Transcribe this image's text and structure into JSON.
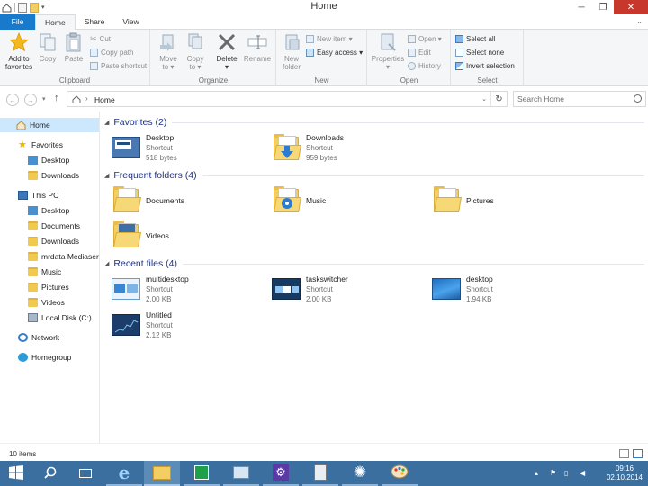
{
  "window": {
    "title": "Home",
    "minimize": "─",
    "maximize": "❐",
    "close": "✕"
  },
  "ribbon_tabs": [
    {
      "label": "File"
    },
    {
      "label": "Home"
    },
    {
      "label": "Share"
    },
    {
      "label": "View"
    }
  ],
  "ribbon": {
    "clipboard": {
      "label": "Clipboard",
      "add_to_favorites": "Add to\nfavorites",
      "copy": "Copy",
      "paste": "Paste",
      "cut": "Cut",
      "copy_path": "Copy path",
      "paste_shortcut": "Paste shortcut"
    },
    "organize": {
      "label": "Organize",
      "move_to": "Move\nto ▾",
      "copy_to": "Copy\nto ▾",
      "delete": "Delete\n▾",
      "rename": "Rename"
    },
    "new": {
      "label": "New",
      "new_folder": "New\nfolder",
      "new_item": "New item ▾",
      "easy_access": "Easy access ▾"
    },
    "open": {
      "label": "Open",
      "properties": "Properties\n▾",
      "open": "Open ▾",
      "edit": "Edit",
      "history": "History"
    },
    "select": {
      "label": "Select",
      "select_all": "Select all",
      "select_none": "Select none",
      "invert_selection": "Invert selection"
    }
  },
  "address": {
    "location": "Home",
    "search_placeholder": "Search Home"
  },
  "nav": {
    "home": "Home",
    "favorites": "Favorites",
    "fav_desktop": "Desktop",
    "fav_downloads": "Downloads",
    "this_pc": "This PC",
    "pc_desktop": "Desktop",
    "pc_documents": "Documents",
    "pc_downloads": "Downloads",
    "pc_mrdata": "mrdata Mediaserv",
    "pc_music": "Music",
    "pc_pictures": "Pictures",
    "pc_videos": "Videos",
    "pc_local_disk": "Local Disk (C:)",
    "network": "Network",
    "homegroup": "Homegroup"
  },
  "sections": {
    "favorites": {
      "title": "Favorites (2)",
      "items": [
        {
          "name": "Desktop",
          "type": "Shortcut",
          "size": "518 bytes",
          "icon": "desktop-shortcut"
        },
        {
          "name": "Downloads",
          "type": "Shortcut",
          "size": "959 bytes",
          "icon": "downloads-folder"
        }
      ]
    },
    "frequent": {
      "title": "Frequent folders (4)",
      "items": [
        {
          "name": "Documents",
          "icon": "documents-folder"
        },
        {
          "name": "Music",
          "icon": "music-folder"
        },
        {
          "name": "Pictures",
          "icon": "pictures-folder"
        },
        {
          "name": "Videos",
          "icon": "videos-folder"
        }
      ]
    },
    "recent": {
      "title": "Recent files (4)",
      "items": [
        {
          "name": "multidesktop",
          "type": "Shortcut",
          "size": "2,00 KB",
          "icon": "multidesktop-thumb"
        },
        {
          "name": "taskswitcher",
          "type": "Shortcut",
          "size": "2,00 KB",
          "icon": "taskswitcher-thumb"
        },
        {
          "name": "desktop",
          "type": "Shortcut",
          "size": "1,94 KB",
          "icon": "desktop-thumb"
        },
        {
          "name": "Untitled",
          "type": "Shortcut",
          "size": "2,12 KB",
          "icon": "untitled-thumb"
        }
      ]
    }
  },
  "status": {
    "item_count": "10 items"
  },
  "taskbar": {
    "time": "09:16",
    "date": "02.10.2014"
  },
  "colors": {
    "accent": "#1979ca",
    "taskbar": "#3a6f9f",
    "section_title": "#1e3287",
    "close_button": "#c7372b"
  }
}
